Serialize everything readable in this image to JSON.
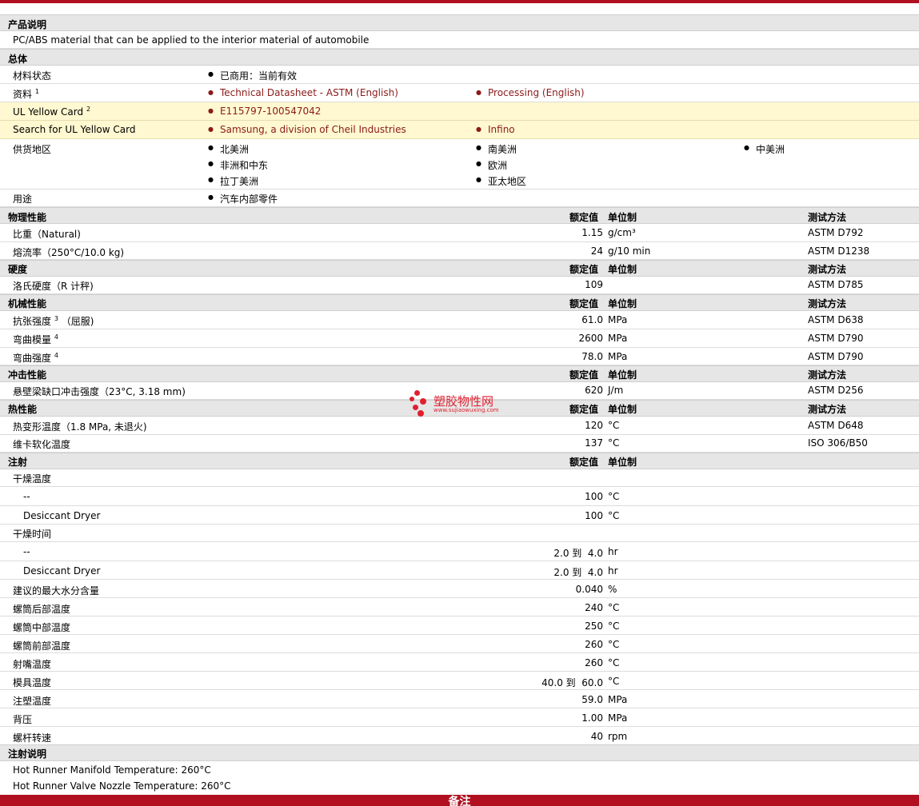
{
  "sections": {
    "desc": "产品说明",
    "general": "总体",
    "physical": "物理性能",
    "hardness": "硬度",
    "mechanical": "机械性能",
    "impact": "冲击性能",
    "thermal": "热性能",
    "injection": "注射",
    "injection_notes": "注射说明",
    "footer": "备注"
  },
  "cols": {
    "value": "额定值",
    "unit": "单位制",
    "method": "测试方法"
  },
  "desc_text": "PC/ABS material that can be applied to the interior material of automobile",
  "general": {
    "status_label": "材料状态",
    "status_value": "已商用：当前有效",
    "docs_label": "资料",
    "docs_sup": "1",
    "doc1": "Technical Datasheet - ASTM (English)",
    "doc2": "Processing (English)",
    "ul_label": "UL Yellow Card",
    "ul_sup": "2",
    "ul_value": "E115797-100547042",
    "search_label": "Search for UL Yellow Card",
    "search1": "Samsung, a division of Cheil Industries",
    "search2": "Infino",
    "supply_label": "供货地区",
    "regions": [
      "北美洲",
      "南美洲",
      "中美洲",
      "非洲和中东",
      "欧洲",
      "拉丁美洲",
      "亚太地区"
    ],
    "use_label": "用途",
    "use_value": "汽车内部零件"
  },
  "physical": [
    {
      "label": "比重（Natural)",
      "value": "1.15",
      "unit": "g/cm³",
      "method": "ASTM D792"
    },
    {
      "label": "熔流率（250°C/10.0 kg)",
      "value": "24",
      "unit": "g/10 min",
      "method": "ASTM D1238"
    }
  ],
  "hardness": [
    {
      "label": "洛氏硬度（R 计秤)",
      "value": "109",
      "unit": "",
      "method": "ASTM D785"
    }
  ],
  "mechanical": [
    {
      "label": "抗张强度",
      "sup": "3",
      "suffix": "（屈服)",
      "value": "61.0",
      "unit": "MPa",
      "method": "ASTM D638"
    },
    {
      "label": "弯曲模量",
      "sup": "4",
      "suffix": "",
      "value": "2600",
      "unit": "MPa",
      "method": "ASTM D790"
    },
    {
      "label": "弯曲强度",
      "sup": "4",
      "suffix": "",
      "value": "78.0",
      "unit": "MPa",
      "method": "ASTM D790"
    }
  ],
  "impact": [
    {
      "label": "悬壁梁缺口冲击强度（23°C, 3.18 mm)",
      "value": "620",
      "unit": "J/m",
      "method": "ASTM D256"
    }
  ],
  "thermal": [
    {
      "label": "热变形温度（1.8 MPa, 未退火)",
      "value": "120",
      "unit": "°C",
      "method": "ASTM D648"
    },
    {
      "label": "维卡软化温度",
      "value": "137",
      "unit": "°C",
      "method": "ISO 306/B50"
    }
  ],
  "injection": [
    {
      "label": "干燥温度",
      "indent": false,
      "value": "",
      "unit": ""
    },
    {
      "label": "--",
      "indent": true,
      "value": "100",
      "unit": "°C"
    },
    {
      "label": "Desiccant Dryer",
      "indent": true,
      "value": "100",
      "unit": "°C"
    },
    {
      "label": "干燥时间",
      "indent": false,
      "value": "",
      "unit": ""
    },
    {
      "label": "--",
      "indent": true,
      "value": "2.0 到  4.0",
      "unit": "hr"
    },
    {
      "label": "Desiccant Dryer",
      "indent": true,
      "value": "2.0 到  4.0",
      "unit": "hr"
    },
    {
      "label": "建议的最大水分含量",
      "indent": false,
      "value": "0.040",
      "unit": "%"
    },
    {
      "label": "螺筒后部温度",
      "indent": false,
      "value": "240",
      "unit": "°C"
    },
    {
      "label": "螺筒中部温度",
      "indent": false,
      "value": "250",
      "unit": "°C"
    },
    {
      "label": "螺筒前部温度",
      "indent": false,
      "value": "260",
      "unit": "°C"
    },
    {
      "label": "射嘴温度",
      "indent": false,
      "value": "260",
      "unit": "°C"
    },
    {
      "label": "模具温度",
      "indent": false,
      "value": "40.0 到  60.0",
      "unit": "°C"
    },
    {
      "label": "注塑温度",
      "indent": false,
      "value": "59.0",
      "unit": "MPa"
    },
    {
      "label": "背压",
      "indent": false,
      "value": "1.00",
      "unit": "MPa"
    },
    {
      "label": "螺杆转速",
      "indent": false,
      "value": "40",
      "unit": "rpm"
    }
  ],
  "injection_notes": [
    "Hot Runner Manifold Temperature: 260°C",
    "Hot Runner Valve Nozzle Temperature: 260°C"
  ],
  "watermark": {
    "name": "塑胶物性网",
    "url": "www.sujiaowuxing.com"
  },
  "colors": {
    "accent": "#b01020",
    "link": "#8b1a1a",
    "header_bg": "#e6e6e6",
    "highlight_bg": "#fff8d0"
  }
}
